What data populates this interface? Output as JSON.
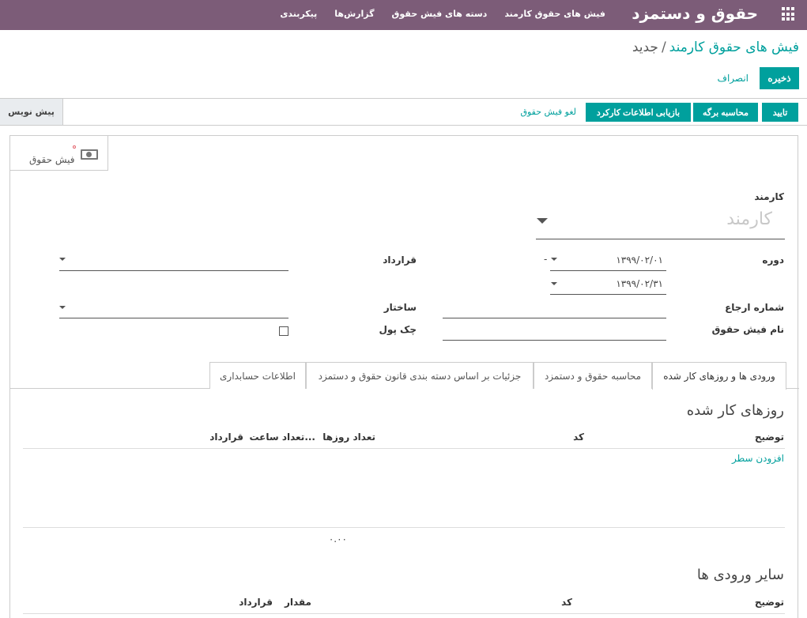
{
  "navbar": {
    "app_title": "حقوق و دستمزد",
    "menu": [
      "فیش های حقوق کارمند",
      "دسته های فیش حقوق",
      "گزارش‌ها",
      "پیکربندی"
    ]
  },
  "breadcrumb": {
    "parent": "فیش های حقوق کارمند",
    "separator": "/",
    "current": "جدید"
  },
  "buttons": {
    "save": "ذخیره",
    "discard": "انصراف"
  },
  "status_actions": {
    "confirm": "تایید",
    "compute_sheet": "محاسبه برگه",
    "recompute_worked": "بازیابی اطلاعات کارکرد",
    "cancel_payslip": "لغو فیش حقوق",
    "stage": "پیش نویس"
  },
  "smart_button": {
    "label": "فیش حقوق",
    "icon": "money-icon"
  },
  "form": {
    "employee_label": "کارمند",
    "employee_placeholder": "کارمند",
    "period_label": "دوره",
    "date_from": "۱۳۹۹/۰۲/۰۱",
    "date_to": "۱۳۹۹/۰۲/۳۱",
    "period_dash": "-",
    "contract_label": "قرارداد",
    "reference_label": "شماره ارجاع",
    "structure_label": "ساختار",
    "payslip_name_label": "نام فیش حقوق",
    "credit_note_label": "چک پول"
  },
  "tabs": [
    "ورودی ها و روزهای کار شده",
    "محاسبه حقوق و دستمزد",
    "جزئیات بر اساس دسته بندی قانون حقوق و دستمزد",
    "اطلاعات حسابداری"
  ],
  "worked_days": {
    "title": "روزهای کار شده",
    "columns": [
      "توضیح",
      "کد",
      "تعداد روزها",
      "تعداد ساعت...",
      "قرارداد"
    ],
    "add_line": "افزودن سطر",
    "total": "۰.۰۰"
  },
  "other_inputs": {
    "title": "سایر ورودی ها",
    "columns": [
      "توضیح",
      "کد",
      "مقدار",
      "قرارداد"
    ]
  },
  "colors": {
    "navbar": "#7c5c78",
    "primary": "#00a09d"
  }
}
